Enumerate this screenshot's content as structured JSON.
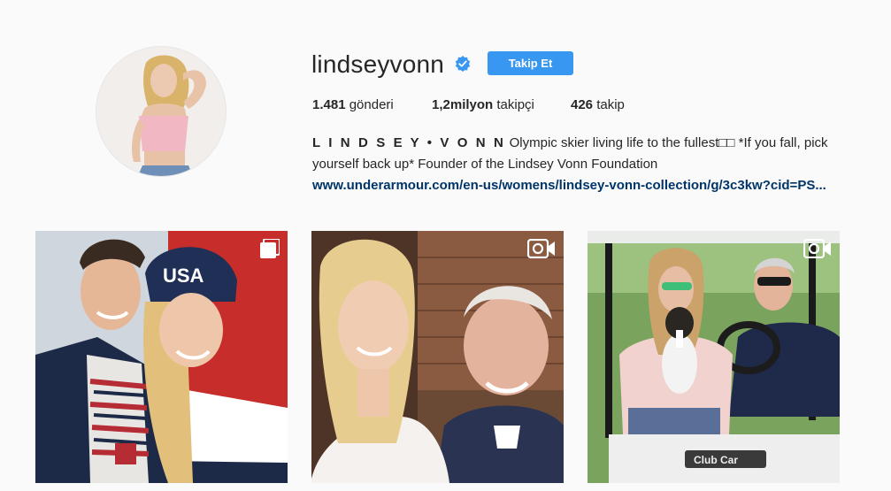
{
  "profile": {
    "username": "lindseyvonn",
    "verified": true,
    "follow_button_label": "Takip Et",
    "avatar_alt": "lindseyvonn",
    "stats": {
      "posts_count": "1.481",
      "posts_label": "gönderi",
      "followers_count": "1,2milyon",
      "followers_label": "takipçi",
      "following_count": "426",
      "following_label": "takip"
    },
    "bio": {
      "name": "L I N D S E Y • V O N N",
      "text": "Olympic skier living life to the fullest□□ *If you fall, pick yourself back up* Founder of the Lindsey Vonn Foundation",
      "link": "www.underarmour.com/en-us/womens/lindsey-vonn-collection/g/3c3kw?cid=PS..."
    }
  },
  "posts": [
    {
      "type": "carousel",
      "badge_icon": "multiple-photos-icon"
    },
    {
      "type": "video",
      "badge_icon": "video-camera-icon"
    },
    {
      "type": "video",
      "badge_icon": "video-camera-icon"
    }
  ],
  "colors": {
    "background": "#fafafa",
    "follow_button": "#3897f0",
    "verified_badge": "#3897f0",
    "link": "#003569"
  }
}
